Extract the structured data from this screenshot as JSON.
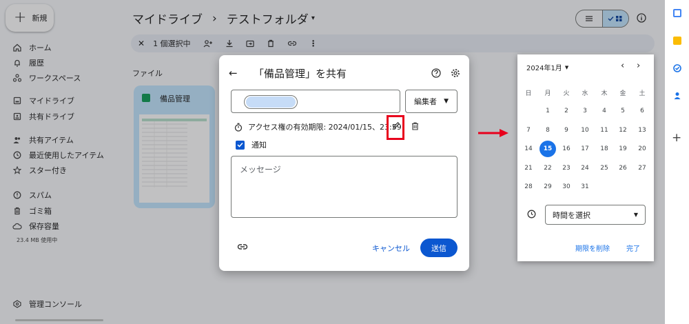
{
  "sidebar": {
    "new_label": "新規",
    "items": [
      {
        "label": "ホーム"
      },
      {
        "label": "履歴"
      },
      {
        "label": "ワークスペース"
      },
      {
        "label": "マイドライブ"
      },
      {
        "label": "共有ドライブ"
      },
      {
        "label": "共有アイテム"
      },
      {
        "label": "最近使用したアイテム"
      },
      {
        "label": "スター付き"
      },
      {
        "label": "スパム"
      },
      {
        "label": "ゴミ箱"
      },
      {
        "label": "保存容量"
      }
    ],
    "storage_used": "23.4 MB 使用中",
    "admin_console": "管理コンソール"
  },
  "header": {
    "breadcrumb_root": "マイドライブ",
    "separator": "›",
    "folder": "テストフォルダ"
  },
  "selection_bar": {
    "count_label": "1 個選択中"
  },
  "files": {
    "section_label": "ファイル",
    "card_name": "備品管理"
  },
  "share_dialog": {
    "title": "「備品管理」を共有",
    "role": "編集者",
    "expiry_text": "アクセス権の有効期限: 2024/01/15、23:59",
    "notify_label": "通知",
    "message_placeholder": "メッセージ",
    "cancel_label": "キャンセル",
    "send_label": "送信"
  },
  "calendar": {
    "month_label": "2024年1月",
    "weekdays": [
      "日",
      "月",
      "火",
      "水",
      "木",
      "金",
      "土"
    ],
    "weeks": [
      [
        "",
        "1",
        "2",
        "3",
        "4",
        "5",
        "6"
      ],
      [
        "7",
        "8",
        "9",
        "10",
        "11",
        "12",
        "13"
      ],
      [
        "14",
        "15",
        "16",
        "17",
        "18",
        "19",
        "20"
      ],
      [
        "21",
        "22",
        "23",
        "24",
        "25",
        "26",
        "27"
      ],
      [
        "28",
        "29",
        "30",
        "31",
        "",
        "",
        ""
      ]
    ],
    "selected_day": "15",
    "time_placeholder": "時間を選択",
    "clear_label": "期限を削除",
    "done_label": "完了"
  },
  "colors": {
    "accent": "#0b57d0",
    "highlight": "#e8001c",
    "selected_day": "#1a73e8"
  }
}
